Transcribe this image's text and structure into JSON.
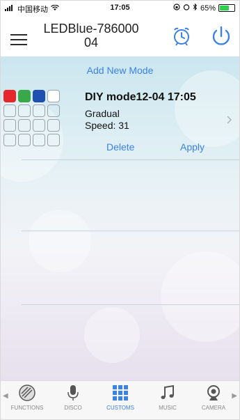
{
  "status_bar": {
    "carrier": "中国移动",
    "time": "17:05",
    "battery": "65%",
    "battery_level": 0.65
  },
  "header": {
    "title_line1": "LEDBlue-786000",
    "title_line2": "04"
  },
  "content": {
    "add_mode_label": "Add New Mode",
    "mode": {
      "name": "DIY mode12-04 17:05",
      "effect": "Gradual",
      "speed": "Speed: 31",
      "delete_label": "Delete",
      "apply_label": "Apply",
      "colors": [
        "#e7262b",
        "#3aa84a",
        "#1f4fb0",
        "#ffffff"
      ],
      "empty_slots": 12
    }
  },
  "tabbar": {
    "tabs": [
      {
        "label": "FUNCTIONS",
        "icon": "functions-icon"
      },
      {
        "label": "DISCO",
        "icon": "microphone-icon"
      },
      {
        "label": "CUSTOMS",
        "icon": "grid-icon",
        "active": true
      },
      {
        "label": "MUSIC",
        "icon": "music-note-icon"
      },
      {
        "label": "CAMERA",
        "icon": "camera-icon"
      }
    ]
  },
  "colors": {
    "accent": "#3b82e6",
    "bg_top": "#cbe6ef"
  }
}
